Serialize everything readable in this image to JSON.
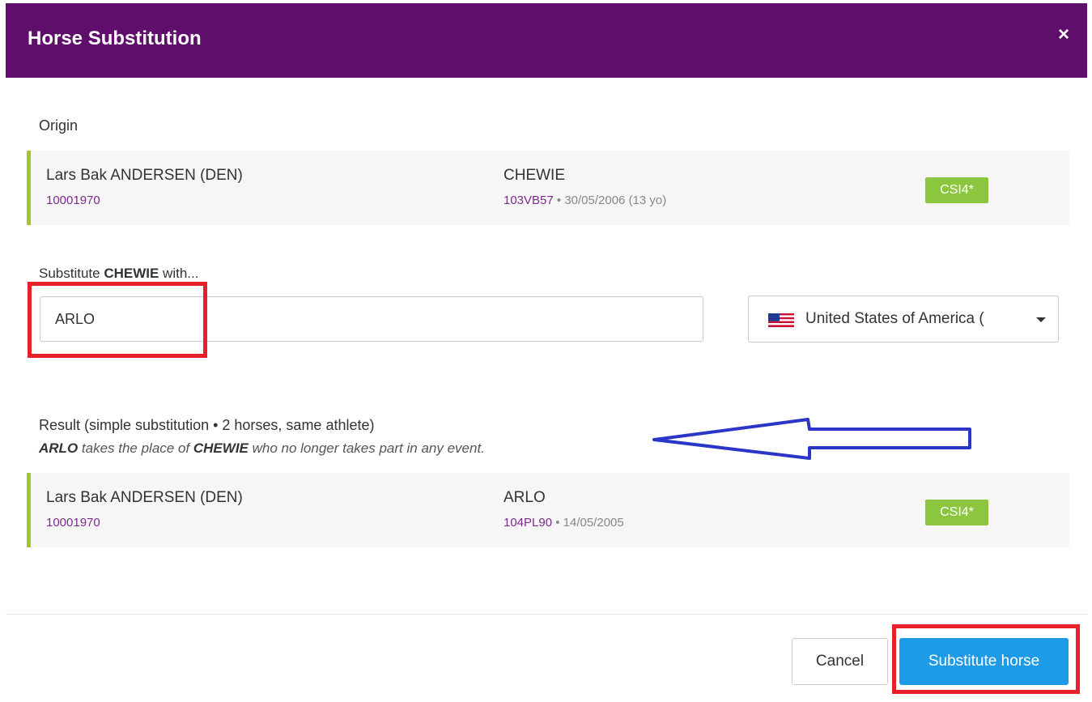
{
  "dialog": {
    "title": "Horse Substitution",
    "close_icon": "×",
    "header_color": "#5f0f6b"
  },
  "origin": {
    "label": "Origin",
    "athlete_name": "Lars Bak ANDERSEN (DEN)",
    "athlete_id": "10001970",
    "horse_name": "CHEWIE",
    "horse_id": "103VB57",
    "horse_details": " • 30/05/2006 (13 yo)",
    "badge": "CSI4*"
  },
  "substitute": {
    "label_prefix": "Substitute ",
    "label_horse": "CHEWIE",
    "label_suffix": " with...",
    "input_value": "ARLO",
    "country_selected": "United States of America (",
    "country_flag_icon": "us-flag-icon"
  },
  "result": {
    "title": "Result (simple substitution • 2 horses, same athlete)",
    "desc_new": "ARLO",
    "desc_mid": " takes the place of ",
    "desc_old": "CHEWIE",
    "desc_end": " who no longer takes part in any event.",
    "athlete_name": "Lars Bak ANDERSEN (DEN)",
    "athlete_id": "10001970",
    "horse_name": "ARLO",
    "horse_id": "104PL90",
    "horse_details": " • 14/05/2005",
    "badge": "CSI4*"
  },
  "footer": {
    "cancel_label": "Cancel",
    "submit_label": "Substitute horse"
  },
  "colors": {
    "accent_green": "#8cc63f",
    "primary_blue": "#1e9be6",
    "link_purple": "#7b2b8a",
    "annotation_red": "#e8202a",
    "annotation_arrow": "#2b36c8"
  }
}
